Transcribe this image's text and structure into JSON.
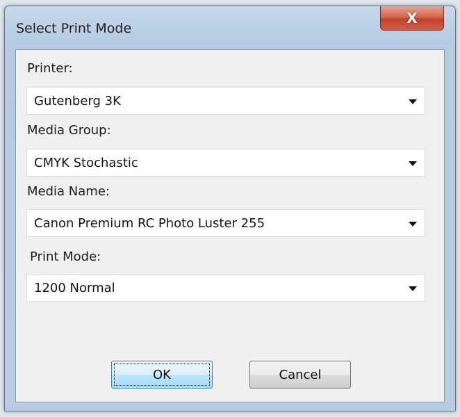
{
  "window": {
    "title": "Select Print Mode",
    "close_label": "X"
  },
  "form": {
    "printer": {
      "label": "Printer:",
      "value": "Gutenberg 3K"
    },
    "media_group": {
      "label": "Media Group:",
      "value": "CMYK Stochastic"
    },
    "media_name": {
      "label": "Media Name:",
      "value": "Canon Premium RC Photo Luster 255"
    },
    "print_mode": {
      "label": "Print Mode:",
      "value": "1200 Normal"
    }
  },
  "buttons": {
    "ok": "OK",
    "cancel": "Cancel"
  },
  "icons": {
    "dropdown": "chevron-down-icon",
    "close": "close-icon"
  }
}
